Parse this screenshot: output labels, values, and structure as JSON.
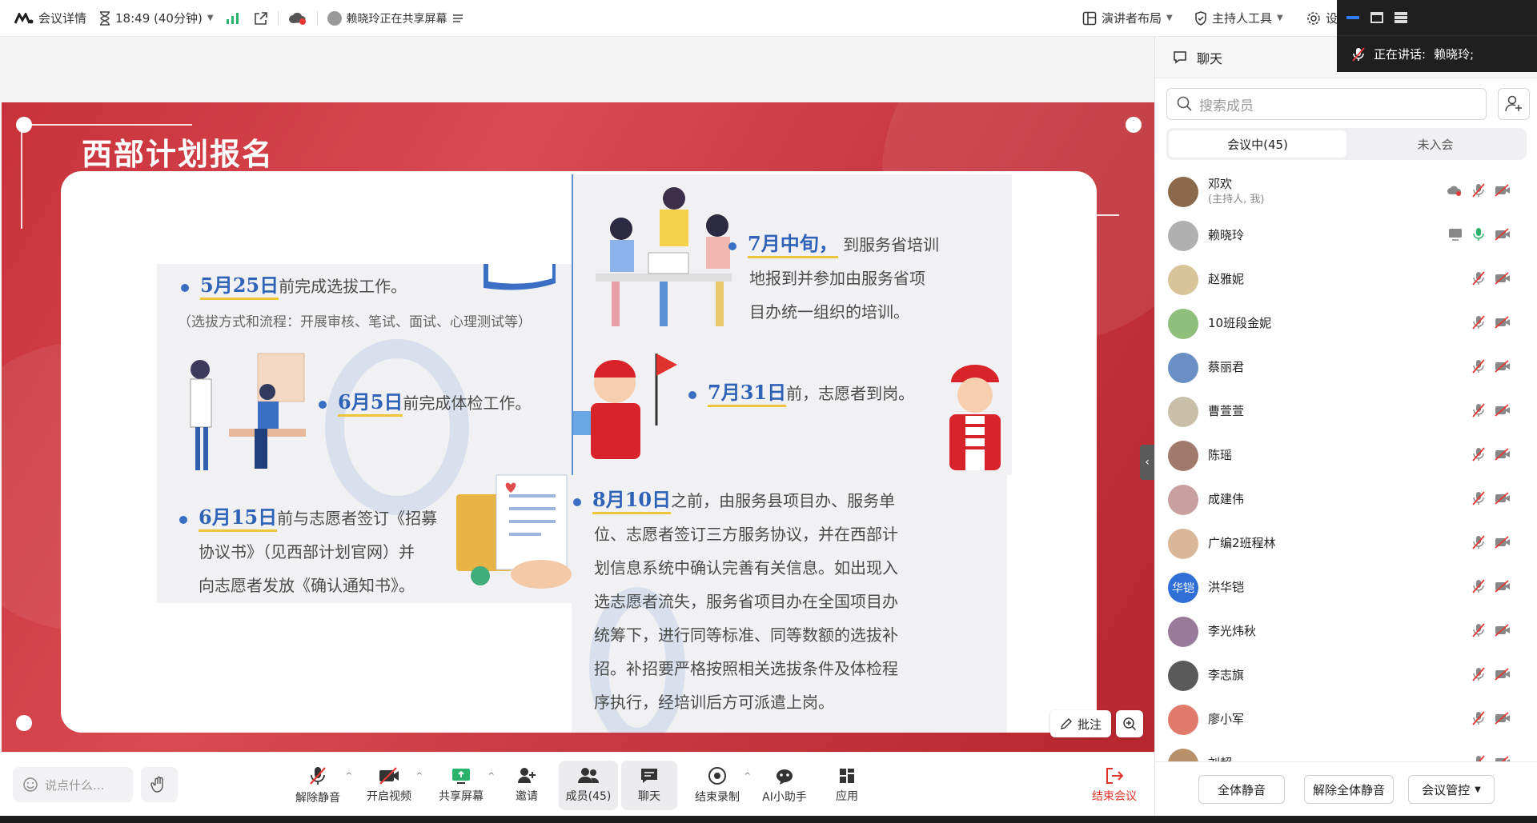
{
  "topbar": {
    "meeting_details": "会议详情",
    "timer": "18:49 (40分钟)",
    "sharer_status": "赖晓玲正在共享屏幕",
    "layout": "演讲者布局",
    "host_tools": "主持人工具",
    "settings_partial": "设"
  },
  "floating": {
    "speaking_label": "正在讲话:",
    "speaking_name": "赖晓玲;"
  },
  "slide": {
    "title": "西部计划报名",
    "item1_date": "5月25日",
    "item1_text": "前完成选拔工作。",
    "item1_note": "（选拔方式和流程：开展审核、笔试、面试、心理测试等）",
    "item2_date": "6月5日",
    "item2_text": "前完成体检工作。",
    "item3_date": "6月15日",
    "item3_line1": "前与志愿者签订《招募",
    "item3_line2": "协议书》（见西部计划官网）并",
    "item3_line3": "向志愿者发放《确认通知书》。",
    "item4_date": "7月中旬，",
    "item4_line1": "到服务省培训",
    "item4_line2": "地报到并参加由服务省项",
    "item4_line3": "目办统一组织的培训。",
    "item5_date": "7月31日",
    "item5_text": "前，志愿者到岗。",
    "item6_date": "8月10日",
    "item6_line1": "之前，由服务县项目办、服务单",
    "item6_line2": "位、志愿者签订三方服务协议，并在西部计",
    "item6_line3": "划信息系统中确认完善有关信息。如出现入",
    "item6_line4": "选志愿者流失，服务省项目办在全国项目办",
    "item6_line5": "统筹下，进行同等标准、同等数额的选拔补",
    "item6_line6": "招。补招要严格按照相关选拔条件及体检程",
    "item6_line7": "序执行，经培训后方可派遣上岗。"
  },
  "share_tools": {
    "annotate": "批注"
  },
  "bottombar": {
    "say_placeholder": "说点什么...",
    "unmute": "解除静音",
    "video": "开启视频",
    "share": "共享屏幕",
    "invite": "邀请",
    "members": "成员(45)",
    "chat": "聊天",
    "record": "结束录制",
    "ai": "AI小助手",
    "apps": "应用",
    "end": "结束会议"
  },
  "panel": {
    "tab_chat": "聊天",
    "search_placeholder": "搜索成员",
    "seg_in": "会议中(45)",
    "seg_out": "未入会",
    "members": [
      {
        "name": "邓欢",
        "sub": "(主持人, 我)",
        "color": "#8a6a4a"
      },
      {
        "name": "赖晓玲",
        "sub": "",
        "color": "#b0b0b0"
      },
      {
        "name": "赵雅妮",
        "sub": "",
        "color": "#d9c49a"
      },
      {
        "name": "10班段金妮",
        "sub": "",
        "color": "#8fbf7a"
      },
      {
        "name": "蔡丽君",
        "sub": "",
        "color": "#6a8fc4"
      },
      {
        "name": "曹萱萱",
        "sub": "",
        "color": "#c9bfa8"
      },
      {
        "name": "陈瑶",
        "sub": "",
        "color": "#a07a6a"
      },
      {
        "name": "成建伟",
        "sub": "",
        "color": "#c8a0a0"
      },
      {
        "name": "广编2班程林",
        "sub": "",
        "color": "#d8b898"
      },
      {
        "name": "洪华铠",
        "sub": "",
        "avatar_text": "华铠",
        "color": "#2f6fd6"
      },
      {
        "name": "李光炜秋",
        "sub": "",
        "color": "#9a7a9a"
      },
      {
        "name": "李志旗",
        "sub": "",
        "color": "#5a5a5a"
      },
      {
        "name": "廖小军",
        "sub": "",
        "color": "#e07a6a"
      },
      {
        "name": "刘超",
        "sub": "",
        "color": "#b8906a"
      }
    ],
    "mute_all": "全体静音",
    "unmute_all": "解除全体静音",
    "control": "会议管控"
  }
}
